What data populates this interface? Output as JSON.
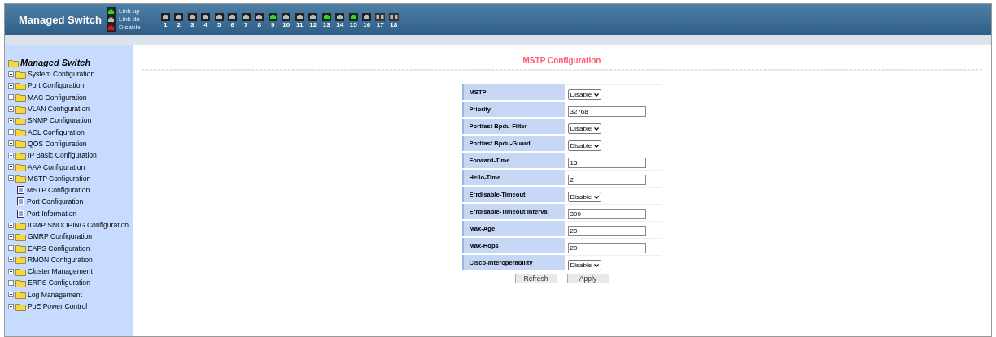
{
  "header": {
    "title": "Managed Switch",
    "legend": [
      {
        "label": "Link up",
        "color": "#22dd22"
      },
      {
        "label": "Link dn",
        "color": "#bbbbbb"
      },
      {
        "label": "Disable",
        "color": "#ee1111"
      }
    ],
    "ports": [
      {
        "label": "1",
        "kind": "copper",
        "link_up": false
      },
      {
        "label": "2",
        "kind": "copper",
        "link_up": false
      },
      {
        "label": "3",
        "kind": "copper",
        "link_up": false
      },
      {
        "label": "4",
        "kind": "copper",
        "link_up": false
      },
      {
        "label": "5",
        "kind": "copper",
        "link_up": false
      },
      {
        "label": "6",
        "kind": "copper",
        "link_up": false
      },
      {
        "label": "7",
        "kind": "copper",
        "link_up": false
      },
      {
        "label": "8",
        "kind": "copper",
        "link_up": false
      },
      {
        "label": "9",
        "kind": "copper",
        "link_up": true
      },
      {
        "label": "10",
        "kind": "copper",
        "link_up": false
      },
      {
        "label": "11",
        "kind": "copper",
        "link_up": false
      },
      {
        "label": "12",
        "kind": "copper",
        "link_up": false
      },
      {
        "label": "13",
        "kind": "copper",
        "link_up": true
      },
      {
        "label": "14",
        "kind": "copper",
        "link_up": false
      },
      {
        "label": "15",
        "kind": "copper",
        "link_up": true
      },
      {
        "label": "16",
        "kind": "copper",
        "link_up": false
      },
      {
        "label": "17",
        "kind": "fiber",
        "link_up": false
      },
      {
        "label": "18",
        "kind": "fiber",
        "link_up": false
      }
    ]
  },
  "sidebar": {
    "root": "Managed Switch",
    "items": [
      {
        "label": "System Configuration",
        "expanded": false
      },
      {
        "label": "Port Configuration",
        "expanded": false
      },
      {
        "label": "MAC Configuration",
        "expanded": false
      },
      {
        "label": "VLAN Configuration",
        "expanded": false
      },
      {
        "label": "SNMP Configuration",
        "expanded": false
      },
      {
        "label": "ACL Configuration",
        "expanded": false
      },
      {
        "label": "QOS Configuration",
        "expanded": false
      },
      {
        "label": "IP Basic Configuration",
        "expanded": false
      },
      {
        "label": "AAA Configuration",
        "expanded": false
      },
      {
        "label": "MSTP Configuration",
        "expanded": true,
        "children": [
          {
            "label": "MSTP Configuration"
          },
          {
            "label": "Port Configuration"
          },
          {
            "label": "Port Information"
          }
        ]
      },
      {
        "label": "IGMP SNOOPING Configuration",
        "expanded": false
      },
      {
        "label": "GMRP Configuration",
        "expanded": false
      },
      {
        "label": "EAPS Configuration",
        "expanded": false
      },
      {
        "label": "RMON Configuration",
        "expanded": false
      },
      {
        "label": "Cluster Management",
        "expanded": false
      },
      {
        "label": "ERPS Configuration",
        "expanded": false
      },
      {
        "label": "Log Management",
        "expanded": false
      },
      {
        "label": "PoE Power Control",
        "expanded": false
      }
    ]
  },
  "main": {
    "title": "MSTP Configuration",
    "fields": [
      {
        "label": "MSTP",
        "kind": "select",
        "value": "Disable"
      },
      {
        "label": "Priority",
        "kind": "text",
        "value": "32768"
      },
      {
        "label": "Portfast Bpdu-Filter",
        "kind": "select",
        "value": "Disable"
      },
      {
        "label": "Portfast Bpdu-Guard",
        "kind": "select",
        "value": "Disable"
      },
      {
        "label": "Forward-Time",
        "kind": "text",
        "value": "15"
      },
      {
        "label": "Hello-Time",
        "kind": "text",
        "value": "2"
      },
      {
        "label": "Errdisable-Timeout",
        "kind": "select",
        "value": "Disable"
      },
      {
        "label": "Errdisable-Timeout Interval",
        "kind": "text",
        "value": "300"
      },
      {
        "label": "Max-Age",
        "kind": "text",
        "value": "20"
      },
      {
        "label": "Max-Hops",
        "kind": "text",
        "value": "20"
      },
      {
        "label": "Cisco-Interoperability",
        "kind": "select",
        "value": "Disable"
      }
    ],
    "buttons": [
      "Refresh",
      "Apply"
    ]
  }
}
